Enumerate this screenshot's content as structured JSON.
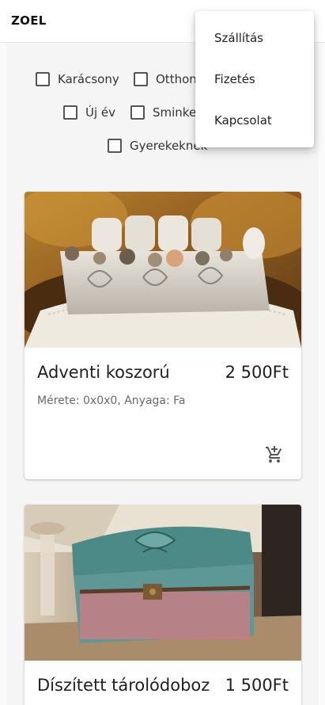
{
  "app": {
    "brand": "ZOEL"
  },
  "filters": [
    {
      "label": "Karácsony"
    },
    {
      "label": "Otthon"
    },
    {
      "label": "Új év"
    },
    {
      "label": "Sminkelés"
    },
    {
      "label": "Gyerekeknek"
    }
  ],
  "products": [
    {
      "title": "Adventi koszorú",
      "price": "2 500Ft",
      "meta": "Mérete: 0x0x0, Anyaga: Fa"
    },
    {
      "title": "Díszített tárolódoboz",
      "price": "1 500Ft"
    }
  ],
  "menu": {
    "items": [
      {
        "label": "Szállítás"
      },
      {
        "label": "Fizetés"
      },
      {
        "label": "Kapcsolat"
      }
    ]
  },
  "icons": {
    "cart": "add-shopping-cart-icon"
  },
  "colors": {
    "accent": "#ffffff",
    "text": "#212121",
    "muted": "#6a6a6a"
  }
}
